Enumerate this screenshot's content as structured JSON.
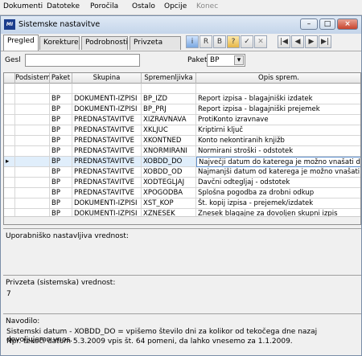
{
  "menu": [
    "Dokumenti",
    "Datoteke",
    "Poročila",
    "Ostalo",
    "Opcije",
    "Konec"
  ],
  "window": {
    "title": "Sistemske nastavitve",
    "app_icon_text": "MI",
    "minimize": "–",
    "maximize": "□",
    "close": "×"
  },
  "tabs": [
    "Pregled",
    "Korekture",
    "Podrobnosti",
    "Privzeta koda"
  ],
  "toolbar": {
    "buttons": [
      "i",
      "R",
      "B",
      "?",
      "✓",
      "✕",
      "|◀",
      "◀",
      "▶",
      "▶|"
    ]
  },
  "filter": {
    "gesl_label": "Gesl",
    "gesl_value": "",
    "paket_label": "Paket",
    "paket_value": "BP",
    "dropdown_arrow": "▾"
  },
  "grid": {
    "columns": [
      "Podsistem",
      "Paket",
      "Skupina",
      "Spremenljivka",
      "Opis sprem."
    ],
    "rows": [
      [
        "",
        "",
        "",
        "",
        ""
      ],
      [
        "",
        "BP",
        "DOKUMENTI-IZPISI",
        "BP_IZD",
        "Report izpisa - blagajniški izdatek"
      ],
      [
        "",
        "BP",
        "DOKUMENTI-IZPISI",
        "BP_PRJ",
        "Report izpisa - blagajniški prejemek"
      ],
      [
        "",
        "BP",
        "PREDNASTAVITVE",
        "XIZRAVNAVA",
        "ProtiKonto izravnave"
      ],
      [
        "",
        "BP",
        "PREDNASTAVITVE",
        "XKLJUC",
        "Kriptirni ključ"
      ],
      [
        "",
        "BP",
        "PREDNASTAVITVE",
        "XKONTNED",
        "Konto nekontiranih knjižb"
      ],
      [
        "",
        "BP",
        "PREDNASTAVITVE",
        "XNORMIRANI",
        "Normirani stroški - odstotek"
      ],
      [
        "",
        "BP",
        "PREDNASTAVITVE",
        "XOBDD_DO",
        "Največji datum do katerega je možno vnašati dok."
      ],
      [
        "",
        "BP",
        "PREDNASTAVITVE",
        "XOBDD_OD",
        "Najmanjši datum od katerega je možno vnašati dok."
      ],
      [
        "",
        "BP",
        "PREDNASTAVITVE",
        "XODTEGLJAJ",
        "Davčni odtegljaj - odstotek"
      ],
      [
        "",
        "BP",
        "PREDNASTAVITVE",
        "XPOGODBA",
        "Splošna pogodba za drobni odkup"
      ],
      [
        "",
        "BP",
        "DOKUMENTI-IZPISI",
        "XST_KOP",
        "Št. kopij izpisa - prejemek/izdatek"
      ],
      [
        "",
        "BP",
        "DOKUMENTI-IZPISI",
        "XZNESEK",
        "Znesek blagajne za dovoljen skupni izpis"
      ]
    ],
    "selected_row": 7,
    "row_marker": "▸"
  },
  "user_value": {
    "label": "Uporabniško nastavljiva vrednost:",
    "value": ""
  },
  "default_value": {
    "label": "Privzeta (sistemska) vrednost:",
    "value": "7"
  },
  "instructions": {
    "label": "Navodilo:",
    "line1": "Sistemski datum - XOBDD_DO = vpišemo število dni za kolikor od tekočega dne nazaj dovoljujemo vnos.",
    "line2": "Npr. tekoči datum 5.3.2009 vpis št. 64 pomeni, da lahko vnesemo za 1.1.2009."
  }
}
